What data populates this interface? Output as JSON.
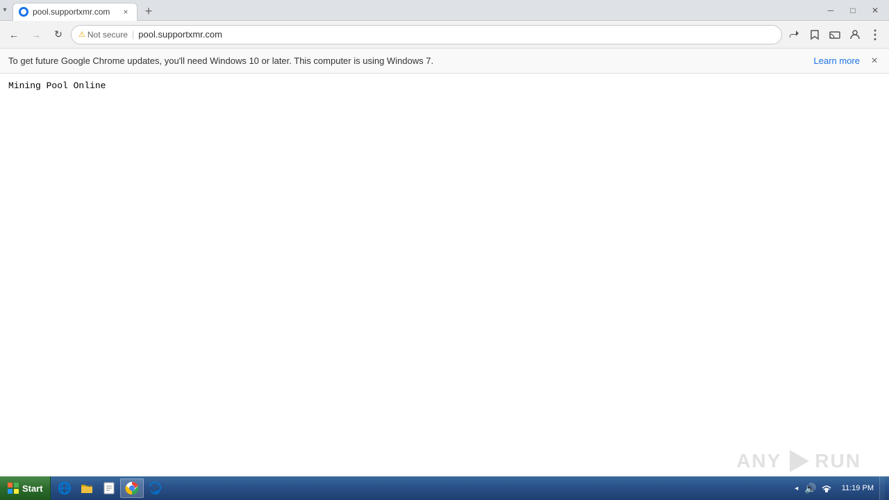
{
  "titlebar": {
    "tab": {
      "title": "pool.supportxmr.com",
      "favicon_color": "#4285f4"
    },
    "new_tab_label": "+",
    "dropdown_arrow": "▾",
    "controls": {
      "minimize": "─",
      "maximize": "□",
      "close": "✕"
    }
  },
  "navbar": {
    "back_disabled": false,
    "forward_disabled": true,
    "reload": "↻",
    "security_label": "Not secure",
    "address": "pool.supportxmr.com",
    "share_icon": "share",
    "bookmark_icon": "☆",
    "tabcast_icon": "⬡",
    "profile_icon": "👤",
    "menu_icon": "⋮"
  },
  "infobar": {
    "message": "To get future Google Chrome updates, you'll need Windows 10 or later. This computer is using Windows 7.",
    "learn_more": "Learn more",
    "close_icon": "×"
  },
  "page": {
    "content": "Mining Pool Online"
  },
  "watermark": {
    "text_any": "ANY",
    "text_run": "RUN"
  },
  "taskbar": {
    "start_label": "Start",
    "items": [
      {
        "icon": "ie",
        "label": "Internet Explorer"
      },
      {
        "icon": "folder",
        "label": "File Explorer"
      },
      {
        "icon": "notepad",
        "label": "Notepad"
      },
      {
        "icon": "chrome",
        "label": "Google Chrome"
      },
      {
        "icon": "edge",
        "label": "Microsoft Edge"
      }
    ],
    "systray": {
      "arrow": "◂",
      "speaker": "🔊",
      "network": "🖧",
      "time": "11:19 PM"
    }
  }
}
